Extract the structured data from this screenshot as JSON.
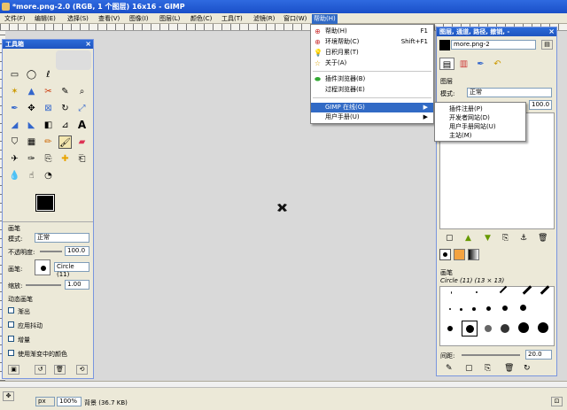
{
  "window": {
    "title": "*more.png-2.0 (RGB, 1 个图层) 16x16 - GIMP"
  },
  "menubar": {
    "items": [
      "文件(F)",
      "编辑(E)",
      "选择(S)",
      "查看(V)",
      "图像(I)",
      "图层(L)",
      "颜色(C)",
      "工具(T)",
      "滤镜(R)",
      "窗口(W)",
      "帮助(H)"
    ]
  },
  "help_menu": {
    "items": [
      {
        "label": "帮助(H)",
        "shortcut": "F1",
        "icon": "help-icon"
      },
      {
        "label": "环境帮助(C)",
        "shortcut": "Shift+F1",
        "icon": "context-help-icon"
      },
      {
        "label": "日积月累(T)",
        "shortcut": "",
        "icon": "tip-lightbulb-icon"
      },
      {
        "label": "关于(A)",
        "shortcut": "",
        "icon": "about-star-icon"
      },
      {
        "label": "插件浏览器(B)",
        "shortcut": "",
        "icon": "plugin-icon"
      },
      {
        "label": "过程浏览器(E)",
        "shortcut": "",
        "icon": "procedure-icon"
      },
      {
        "label": "GIMP 在线(G)",
        "shortcut": "",
        "icon": ""
      },
      {
        "label": "用户手册(U)",
        "shortcut": "",
        "icon": ""
      }
    ]
  },
  "online_submenu": {
    "items": [
      "插件注册(P)",
      "开发者网站(D)",
      "用户手册网站(U)",
      "主站(M)"
    ]
  },
  "toolbox": {
    "title": "工具箱",
    "options_title": "画笔",
    "mode_label": "模式:",
    "mode_value": "正常",
    "opacity_label": "不透明度:",
    "opacity_value": "100.0",
    "brush_label": "画笔:",
    "brush_value": "Circle (11)",
    "scale_label": "缩放:",
    "scale_value": "1.00",
    "dynamics_label": "动态画笔",
    "fade_label": "渐出",
    "jitter_label": "应用抖动",
    "incremental_label": "增量",
    "gradient_label": "使用渐变中的颜色"
  },
  "layers_dock": {
    "title": "图层, 通道, 路径, 撤销, -",
    "image_selector": "more.png-2",
    "tab_label": "图层",
    "mode_label": "模式:",
    "mode_value": "正常",
    "opacity_value": "100.0",
    "brushes_label": "画笔",
    "brushes_value": "Circle (11) (13 × 13)",
    "spacing_label": "间距:",
    "spacing_value": "20.0"
  },
  "statusbar": {
    "unit": "px",
    "zoom": "100%",
    "message": "背景 (36.7 KB)"
  }
}
